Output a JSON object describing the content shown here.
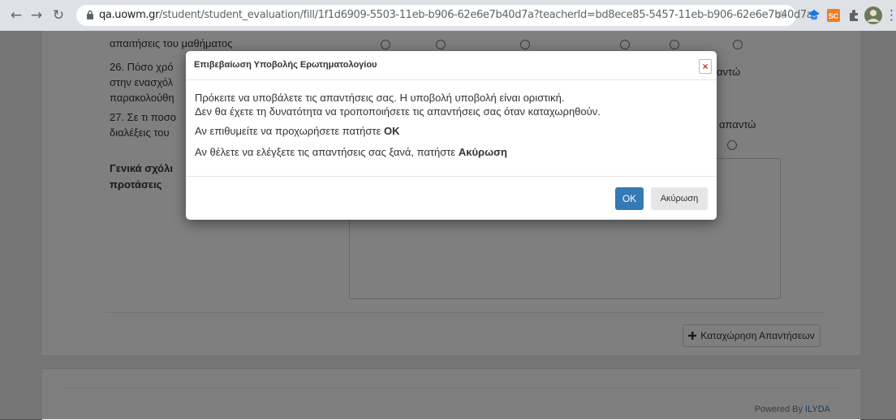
{
  "browser": {
    "url_host": "qa.uowm.gr",
    "url_path": "/student/student_evaluation/fill/1f1d6909-5503-11eb-b906-62e6e7b40d7a?teacherId=bd8ece85-5457-11eb-b906-62e6e7b40d7a",
    "icons": [
      "back-icon",
      "forward-icon",
      "reload-icon",
      "lock-icon",
      "bookmark-star-icon",
      "extension-icon",
      "profile-avatar"
    ]
  },
  "page": {
    "q25_text": "απαιτήσεις του μαθήματος",
    "q26_text": [
      "26. Πόσο χρό",
      "στην ενασχόλ",
      "παρακολούθη"
    ],
    "q26_tail": "αντώ",
    "q27_text": [
      "27. Σε τι ποσο",
      "διαλέξεις του"
    ],
    "q27_tail": "απαντώ",
    "comments_label": [
      "Γενικά σχόλι",
      "προτάσεις"
    ],
    "submit_label": "Καταχώρηση Απαντήσεων",
    "powered_by": "Powered By",
    "powered_brand": "ILYDA"
  },
  "modal": {
    "title": "Επιβεβαίωση Υποβολής Ερωτηματολογίου",
    "close": "×",
    "line1": "Πρόκειτε να υποβάλετε τις απαντήσεις σας. Η υποβολή υποβολή είναι οριστική.",
    "line2": "Δεν θα έχετε τη δυνατότητα να τροποποιήσετε τις απαντήσεις σας όταν καταχωρηθούν.",
    "line3_prefix": "Αν επιθυμείτε να προχωρήσετε πατήστε",
    "line3_bold": "OK",
    "line4_prefix": "Αν θέλετε να ελέγξετε τις απαντήσεις σας ξανά, πατήστε",
    "line4_bold": "Ακύρωση",
    "ok_label": "OK",
    "cancel_label": "Ακύρωση"
  },
  "colors": {
    "primary": "#337ab7",
    "close_red": "#c9302c"
  }
}
